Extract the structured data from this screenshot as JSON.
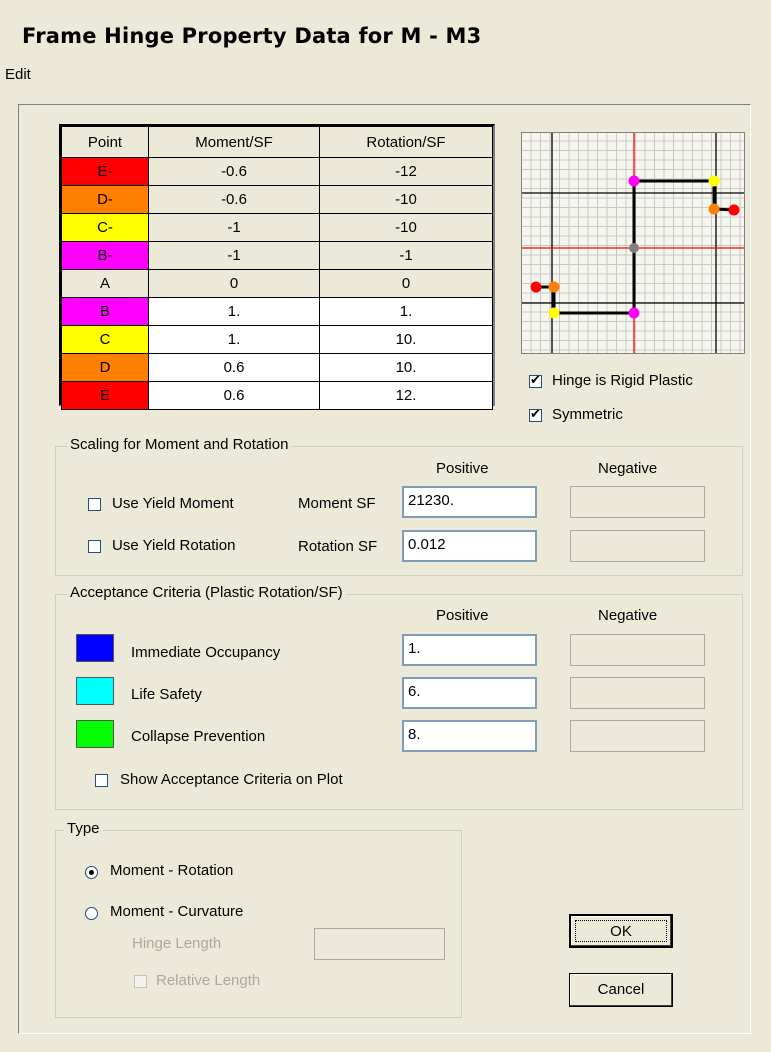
{
  "window": {
    "title": "Frame Hinge Property Data for M - M3"
  },
  "menu": {
    "edit": "Edit"
  },
  "table": {
    "headers": [
      "Point",
      "Moment/SF",
      "Rotation/SF"
    ],
    "rows": [
      {
        "point": "E-",
        "moment": "-0.6",
        "rotation": "-12",
        "color": "#ff0000"
      },
      {
        "point": "D-",
        "moment": "-0.6",
        "rotation": "-10",
        "color": "#ff8000"
      },
      {
        "point": "C-",
        "moment": "-1",
        "rotation": "-10",
        "color": "#ffff00"
      },
      {
        "point": "B-",
        "moment": "-1",
        "rotation": "-1",
        "color": "#ff00ff"
      },
      {
        "point": "A",
        "moment": "0",
        "rotation": "0",
        "color": "#ece9d8"
      },
      {
        "point": "B",
        "moment": "1.",
        "rotation": "1.",
        "color": "#ff00ff"
      },
      {
        "point": "C",
        "moment": "1.",
        "rotation": "10.",
        "color": "#ffff00"
      },
      {
        "point": "D",
        "moment": "0.6",
        "rotation": "10.",
        "color": "#ff8000"
      },
      {
        "point": "E",
        "moment": "0.6",
        "rotation": "12.",
        "color": "#ff0000"
      }
    ]
  },
  "options": {
    "rigid_plastic": "Hinge is Rigid Plastic",
    "symmetric": "Symmetric"
  },
  "scaling": {
    "title": "Scaling for Moment and Rotation",
    "positive": "Positive",
    "negative": "Negative",
    "use_yield_moment": "Use Yield Moment",
    "use_yield_rotation": "Use Yield Rotation",
    "moment_sf_label": "Moment SF",
    "rotation_sf_label": "Rotation SF",
    "moment_sf": "21230.",
    "rotation_sf": "0.012"
  },
  "acceptance": {
    "title": "Acceptance Criteria (Plastic Rotation/SF)",
    "positive": "Positive",
    "negative": "Negative",
    "io_label": "Immediate Occupancy",
    "ls_label": "Life Safety",
    "cp_label": "Collapse Prevention",
    "io_value": "1.",
    "ls_value": "6.",
    "cp_value": "8.",
    "io_color": "#0000ff",
    "ls_color": "#00ffff",
    "cp_color": "#00ff00",
    "show_on_plot": "Show Acceptance Criteria on Plot"
  },
  "type": {
    "title": "Type",
    "moment_rotation": "Moment - Rotation",
    "moment_curvature": "Moment - Curvature",
    "hinge_length": "Hinge Length",
    "relative_length": "Relative Length"
  },
  "buttons": {
    "ok": "OK",
    "cancel": "Cancel"
  }
}
